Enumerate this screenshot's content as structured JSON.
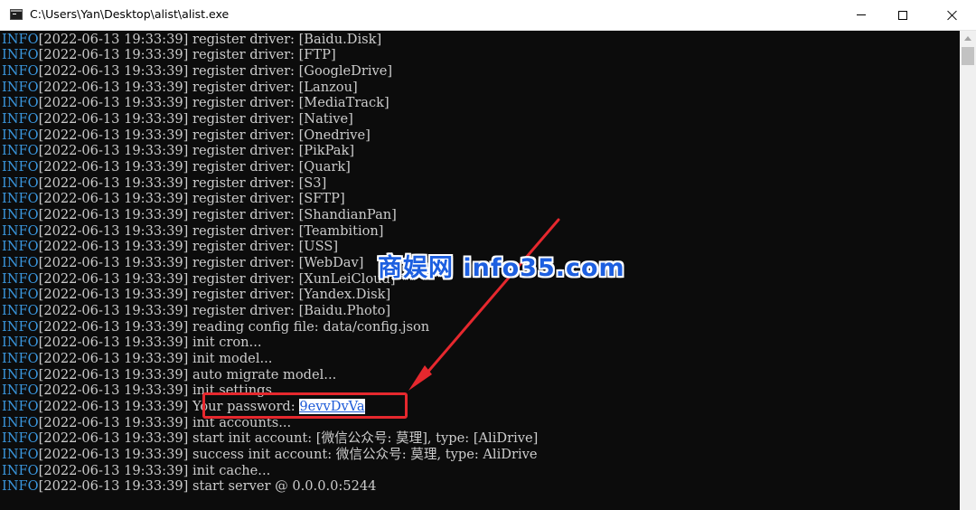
{
  "window": {
    "title": "C:\\Users\\Yan\\Desktop\\alist\\alist.exe",
    "buttons": {
      "minimize": "minimize",
      "maximize": "maximize",
      "close": "close"
    }
  },
  "console": {
    "level": "INFO",
    "timestamp": "[2022-06-13 19:33:39]",
    "lines": [
      " register driver: [Baidu.Disk]",
      " register driver: [FTP]",
      " register driver: [GoogleDrive]",
      " register driver: [Lanzou]",
      " register driver: [MediaTrack]",
      " register driver: [Native]",
      " register driver: [Onedrive]",
      " register driver: [PikPak]",
      " register driver: [Quark]",
      " register driver: [S3]",
      " register driver: [SFTP]",
      " register driver: [ShandianPan]",
      " register driver: [Teambition]",
      " register driver: [USS]",
      " register driver: [WebDav]",
      " register driver: [XunLeiCloud]",
      " register driver: [Yandex.Disk]",
      " register driver: [Baidu.Photo]",
      " reading config file: data/config.json",
      " init cron...",
      " init model...",
      " auto migrate model...",
      " init settings...",
      " Your password: ",
      " init accounts...",
      " start init account: [微信公众号: 莫理], type: [AliDrive]",
      " success init account: 微信公众号: 莫理, type: AliDrive",
      " init cache...",
      " start server @ 0.0.0.0:5244"
    ],
    "password_value": "9evvDvVa"
  },
  "overlay": {
    "watermark": "商娱网 info35.com",
    "highlight_color": "#e6282e",
    "watermark_color": "#1d5fe0"
  },
  "colors": {
    "background": "#0c0c0c",
    "text": "#cccccc",
    "info_level": "#3a96dd"
  }
}
